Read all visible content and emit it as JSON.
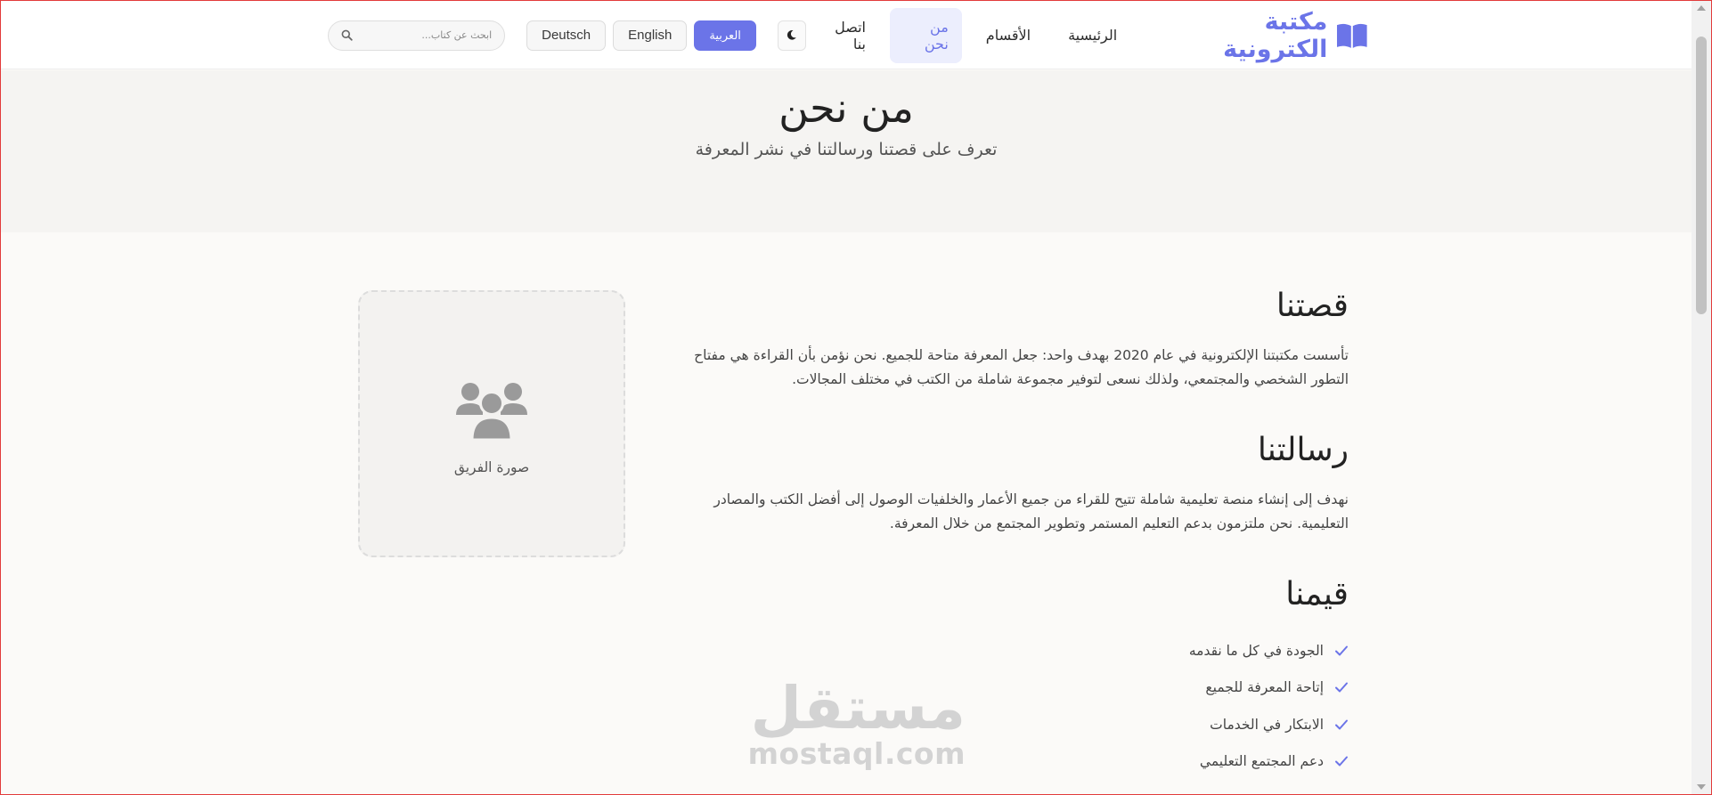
{
  "nav": {
    "brand": "مكتبة الكترونية",
    "links": [
      {
        "label": "الرئيسية",
        "active": false
      },
      {
        "label": "الأقسام",
        "active": false
      },
      {
        "label": "من نحن",
        "active": true
      },
      {
        "label": "اتصل بنا",
        "active": false
      }
    ],
    "languages": [
      {
        "label": "العربية",
        "active": true
      },
      {
        "label": "English",
        "active": false
      },
      {
        "label": "Deutsch",
        "active": false
      }
    ],
    "search_placeholder": "ابحث عن كتاب..."
  },
  "hero": {
    "title": "من نحن",
    "subtitle": "تعرف على قصتنا ورسالتنا في نشر المعرفة"
  },
  "story": {
    "heading": "قصتنا",
    "body": "تأسست مكتبتنا الإلكترونية في عام 2020 بهدف واحد: جعل المعرفة متاحة للجميع. نحن نؤمن بأن القراءة هي مفتاح التطور الشخصي والمجتمعي، ولذلك نسعى لتوفير مجموعة شاملة من الكتب في مختلف المجالات."
  },
  "mission": {
    "heading": "رسالتنا",
    "body": "نهدف إلى إنشاء منصة تعليمية شاملة تتيح للقراء من جميع الأعمار والخلفيات الوصول إلى أفضل الكتب والمصادر التعليمية. نحن ملتزمون بدعم التعليم المستمر وتطوير المجتمع من خلال المعرفة."
  },
  "values": {
    "heading": "قيمنا",
    "items": [
      "الجودة في كل ما نقدمه",
      "إتاحة المعرفة للجميع",
      "الابتكار في الخدمات",
      "دعم المجتمع التعليمي"
    ]
  },
  "team": {
    "caption": "صورة الفريق"
  },
  "watermark": {
    "arabic": "مستقل",
    "latin": "mostaql.com"
  },
  "colors": {
    "accent": "#6b74e8",
    "hero_bg": "#f5f4f2",
    "page_bg": "#fbfaf8"
  },
  "icons": {
    "brand": "book-open-icon",
    "theme": "moon-icon",
    "search": "search-icon",
    "team": "users-icon",
    "value_bullet": "check-icon"
  }
}
